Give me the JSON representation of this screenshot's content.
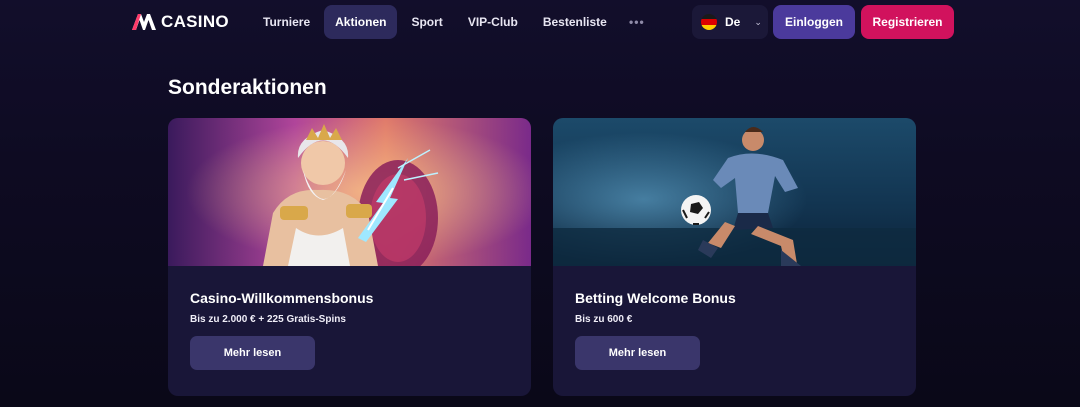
{
  "brand": {
    "logo_text": "CASINO",
    "accent": "#d1125d",
    "logo_mark_color": "#ff3b6a"
  },
  "nav": {
    "items": [
      {
        "label": "Turniere",
        "active": false
      },
      {
        "label": "Aktionen",
        "active": true
      },
      {
        "label": "Sport",
        "active": false
      },
      {
        "label": "VIP-Club",
        "active": false
      },
      {
        "label": "Bestenliste",
        "active": false
      }
    ],
    "more_label": "•••"
  },
  "language": {
    "label": "De",
    "flag": "germany-flag-icon"
  },
  "auth": {
    "login_label": "Einloggen",
    "register_label": "Registrieren"
  },
  "page": {
    "title": "Sonderaktionen"
  },
  "promotions": [
    {
      "title": "Casino-Willkommensbonus",
      "subtitle": "Bis zu 2.000 € + 225 Gratis-Spins",
      "button": "Mehr lesen",
      "image": "zeus-lightning-illustration"
    },
    {
      "title": "Betting Welcome Bonus",
      "subtitle": "Bis zu 600 €",
      "button": "Mehr lesen",
      "image": "soccer-player-kicking-ball-illustration"
    }
  ]
}
